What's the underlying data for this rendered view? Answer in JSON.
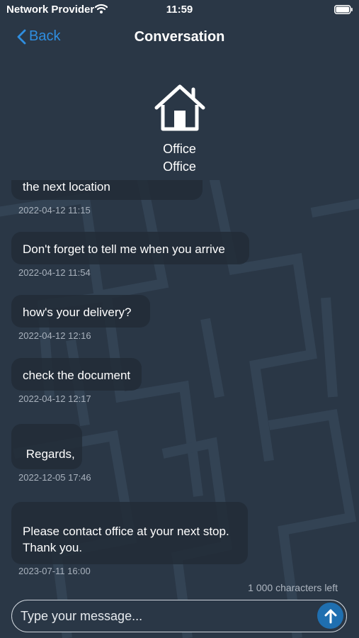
{
  "status_bar": {
    "carrier": "Network Provider",
    "time": "11:59",
    "wifi_icon": "wifi-icon",
    "battery_icon": "battery-icon"
  },
  "nav": {
    "back_label": "Back",
    "title": "Conversation",
    "back_icon": "chevron-left-icon"
  },
  "contact": {
    "icon": "home-icon",
    "line1": "Office",
    "line2": "Office"
  },
  "messages": [
    {
      "text": "the next location",
      "time": "2022-04-12 11:15"
    },
    {
      "text": "Don't forget to tell me when you arrive",
      "time": "2022-04-12 11:54"
    },
    {
      "text": "how's your delivery?",
      "time": "2022-04-12 12:16"
    },
    {
      "text": "check the document",
      "time": "2022-04-12 12:17"
    },
    {
      "text": " Regards,",
      "time": "2022-12-05 17:46"
    },
    {
      "text": "Please contact office at your next stop.\nThank you.",
      "time": "2023-07-11 16:00"
    }
  ],
  "composer": {
    "chars_left": "1 000 characters left",
    "placeholder": "Type your message...",
    "send_icon": "arrow-up-icon"
  },
  "colors": {
    "background": "#2a3746",
    "accent": "#2f8ee0",
    "send_button": "#1f6fb0"
  }
}
